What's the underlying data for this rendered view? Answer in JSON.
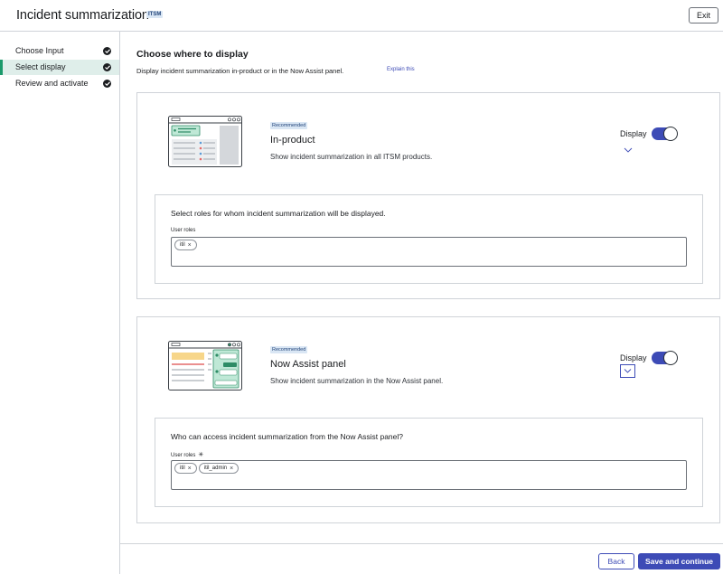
{
  "header": {
    "title": "Incident summarization",
    "badge": "ITSM",
    "exit_label": "Exit"
  },
  "sidebar": {
    "steps": [
      {
        "label": "Choose Input",
        "status": "complete"
      },
      {
        "label": "Select display",
        "status": "complete",
        "active": true
      },
      {
        "label": "Review and activate",
        "status": "complete"
      }
    ]
  },
  "main": {
    "title": "Choose where to display",
    "subtitle": "Display incident summarization in-product or in the Now Assist panel.",
    "explain_link": "Explain this"
  },
  "options": [
    {
      "badge": "Recommended",
      "title": "In-product",
      "description": "Show incident summarization in all ITSM products.",
      "toggle_label": "Display",
      "toggle_on": true,
      "roles_heading": "Select roles for whom incident summarization will be displayed.",
      "roles_label": "User roles",
      "roles": [
        "itil"
      ]
    },
    {
      "badge": "Recommended",
      "title": "Now Assist panel",
      "description": "Show incident summarization in the Now Assist panel.",
      "toggle_label": "Display",
      "toggle_on": true,
      "roles_heading": "Who can access incident summarization from the Now Assist panel?",
      "roles_label": "User roles",
      "required_mark": "✳",
      "roles": [
        "itil",
        "itil_admin"
      ]
    }
  ],
  "footer": {
    "back_label": "Back",
    "save_label": "Save and continue"
  },
  "colors": {
    "accent": "#3d4bb6",
    "active_step_bg": "#dfeeea",
    "active_step_border": "#1b9a6b",
    "badge_bg": "#d9e6f4"
  }
}
